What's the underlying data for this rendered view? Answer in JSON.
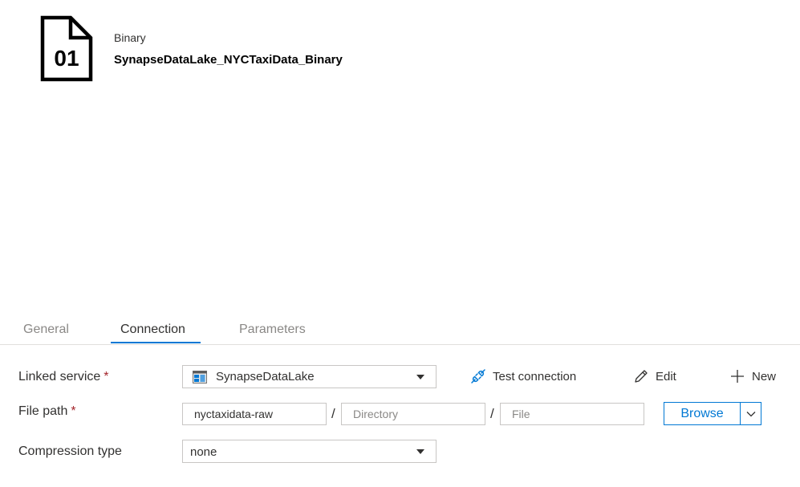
{
  "header": {
    "icon_text": "01",
    "dataset_type": "Binary",
    "dataset_name": "SynapseDataLake_NYCTaxiData_Binary"
  },
  "tabs": [
    {
      "label": "General",
      "active": false
    },
    {
      "label": "Connection",
      "active": true
    },
    {
      "label": "Parameters",
      "active": false
    }
  ],
  "connection": {
    "linked_service": {
      "label": "Linked service",
      "required_mark": "*",
      "value": "SynapseDataLake",
      "icon": "data-lake-storage-icon"
    },
    "actions": {
      "test_connection": "Test connection",
      "edit": "Edit",
      "new": "New"
    },
    "file_path": {
      "label": "File path",
      "required_mark": "*",
      "container_value": "nyctaxidata-raw",
      "separator": "/",
      "directory_placeholder": "Directory",
      "file_placeholder": "File",
      "browse_label": "Browse"
    },
    "compression": {
      "label": "Compression type",
      "value": "none"
    }
  },
  "colors": {
    "accent": "#0078d4",
    "required": "#a4262c",
    "border": "#c8c6c4",
    "muted_text": "#8a8886"
  }
}
